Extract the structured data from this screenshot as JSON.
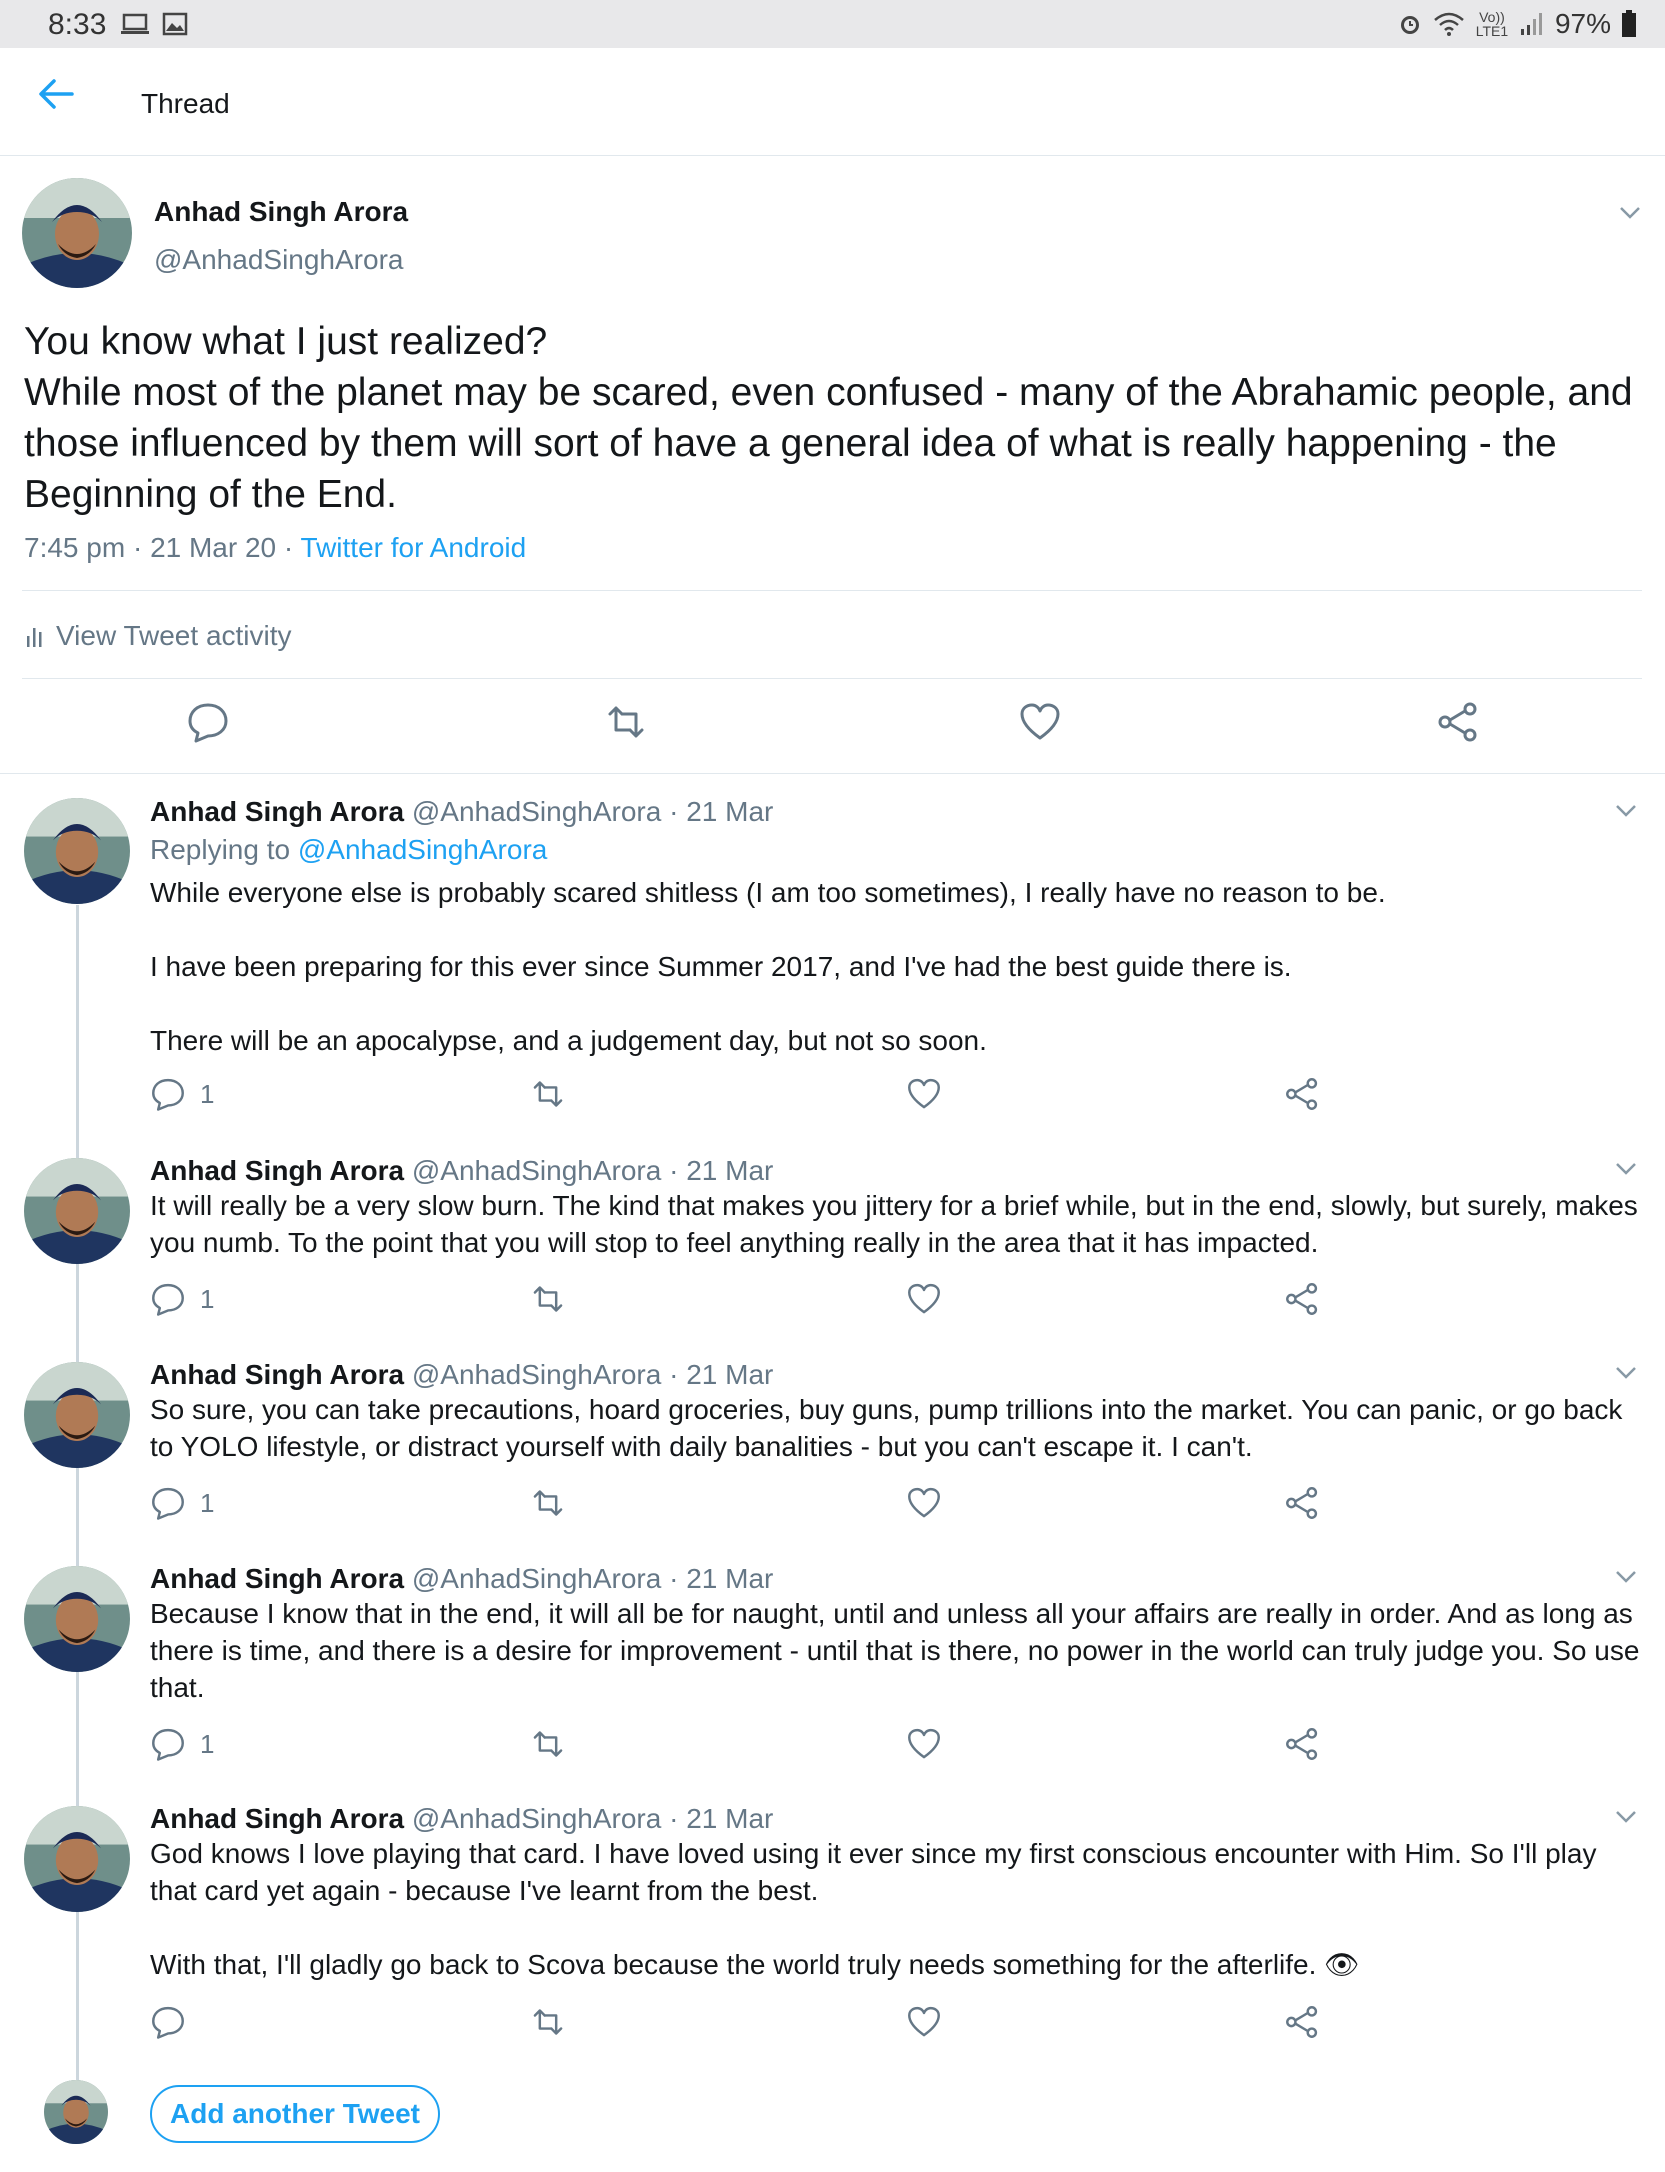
{
  "status_bar": {
    "time": "8:33",
    "left_icons": [
      "laptop-icon",
      "image-icon"
    ],
    "right_icons": [
      "alarm-icon",
      "wifi-icon",
      "volte-icon",
      "signal-icon",
      "battery-icon"
    ],
    "volte_label": "Vo)) LTE1",
    "battery": "97%"
  },
  "header": {
    "title": "Thread",
    "back_icon": "back-arrow-icon"
  },
  "colors": {
    "accent": "#1da1f2",
    "text": "#14171a",
    "muted": "#657786",
    "border": "#e1e8ed"
  },
  "main_tweet": {
    "name": "Anhad Singh Arora",
    "handle": "@AnhadSinghArora",
    "text_lines": [
      "You know what I just realized?",
      "While most of the planet may be scared, even confused - many of the Abrahamic people, and those influenced by them will sort of have a general idea of what is really happening - the Beginning of the End."
    ],
    "time": "7:45 pm",
    "date": "21 Mar 20",
    "source": "Twitter for Android",
    "activity_label": "View Tweet activity"
  },
  "replies": [
    {
      "name": "Anhad Singh Arora",
      "handle": "@AnhadSinghArora",
      "date": "21 Mar",
      "replying_prefix": "Replying to ",
      "replying_to": "@AnhadSinghArora",
      "paragraphs": [
        "While everyone else is probably scared shitless (I am too sometimes), I really have no reason to be.",
        "I have been preparing for this ever since Summer 2017, and I've had the best guide there is.",
        "There will be an apocalypse, and a judgement day, but not so soon."
      ],
      "reply_count": "1"
    },
    {
      "name": "Anhad Singh Arora",
      "handle": "@AnhadSinghArora",
      "date": "21 Mar",
      "paragraphs": [
        "It will really be a very slow burn. The kind that makes you jittery for a brief while, but in the end, slowly, but surely, makes you numb. To the point that you will stop to feel anything really in the area that it has impacted."
      ],
      "reply_count": "1"
    },
    {
      "name": "Anhad Singh Arora",
      "handle": "@AnhadSinghArora",
      "date": "21 Mar",
      "paragraphs": [
        "So sure, you can take precautions, hoard groceries, buy guns, pump trillions into the market. You can panic, or go back to YOLO lifestyle, or distract yourself with daily banalities - but you can't escape it. I can't."
      ],
      "reply_count": "1"
    },
    {
      "name": "Anhad Singh Arora",
      "handle": "@AnhadSinghArora",
      "date": "21 Mar",
      "paragraphs": [
        "Because I know that in the end, it will all be for naught, until and unless all your affairs are really in order. And as long as there is time, and there is a desire for improvement - until that is there, no power in the world can truly judge you. So use that."
      ],
      "reply_count": "1"
    },
    {
      "name": "Anhad Singh Arora",
      "handle": "@AnhadSinghArora",
      "date": "21 Mar",
      "paragraphs": [
        "God knows I love playing that card. I have loved using it ever since my first conscious encounter with Him. So I'll play that card yet again - because I've learnt from the best.",
        "With that, I'll gladly go back to Scova because the world truly needs something for the afterlife. 👁"
      ],
      "reply_count": ""
    }
  ],
  "add_tweet_label": "Add another Tweet",
  "separator": "·"
}
